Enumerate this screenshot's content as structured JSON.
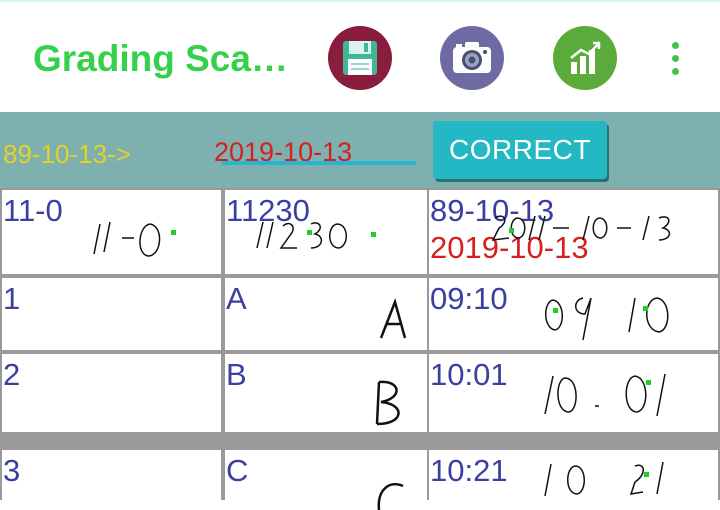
{
  "app": {
    "title": "Grading Sca…"
  },
  "actions": {
    "save_icon": "floppy-disk-icon",
    "camera_icon": "camera-icon",
    "stats_icon": "bar-chart-icon",
    "more_icon": "overflow-menu-icon"
  },
  "toolbar": {
    "source_date": "89-10-13->",
    "target_date": "2019-10-13",
    "correct_label": "CORRECT"
  },
  "rows": [
    {
      "c1": "11-0",
      "c2": "11230",
      "c3": "89-10-13",
      "c3_correction": "2019-10-13"
    },
    {
      "c1": "1",
      "c2": "A",
      "c3": "09:10"
    },
    {
      "c1": "2",
      "c2": "B",
      "c3": "10:01"
    },
    {
      "c1": "3",
      "c2": "C",
      "c3": "10:21"
    }
  ],
  "colors": {
    "accent_green": "#35d14b",
    "toolbar_bg": "#7db0ae",
    "button": "#23b8c4",
    "text_blue": "#3a3fa0",
    "text_red": "#d61f1f",
    "source_yellow": "#e6d227"
  }
}
